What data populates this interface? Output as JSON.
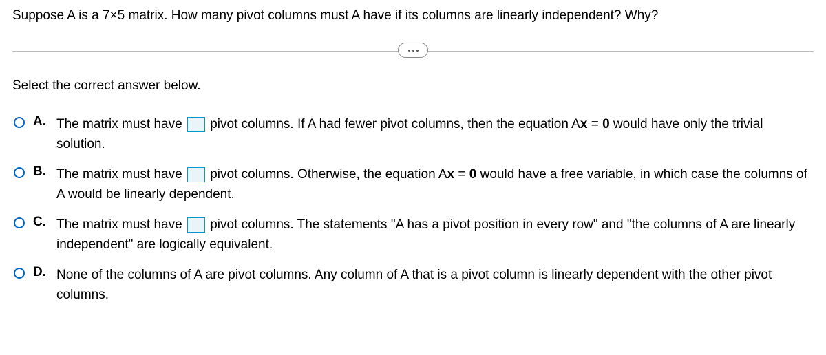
{
  "question": "Suppose A is a 7×5 matrix. How many pivot columns must A have if its columns are linearly independent? Why?",
  "instruction": "Select the correct answer below.",
  "options": {
    "a": {
      "label": "A.",
      "part1": "The matrix must have ",
      "part2": " pivot columns. If A had fewer pivot columns, then the equation A",
      "bold1": "x",
      "part3": " = ",
      "bold2": "0",
      "part4": " would have only the trivial solution."
    },
    "b": {
      "label": "B.",
      "part1": "The matrix must have ",
      "part2": " pivot columns. Otherwise, the equation A",
      "bold1": "x",
      "part3": " = ",
      "bold2": "0",
      "part4": " would have a free variable, in which case the columns of A would be linearly dependent."
    },
    "c": {
      "label": "C.",
      "part1": "The matrix must have ",
      "part2": " pivot columns. The statements \"A has a pivot position in every row\" and \"the columns of A are linearly independent\" are logically equivalent."
    },
    "d": {
      "label": "D.",
      "text": "None of the columns of A are pivot columns. Any column of A that is a pivot column is linearly dependent with the other pivot columns."
    }
  }
}
